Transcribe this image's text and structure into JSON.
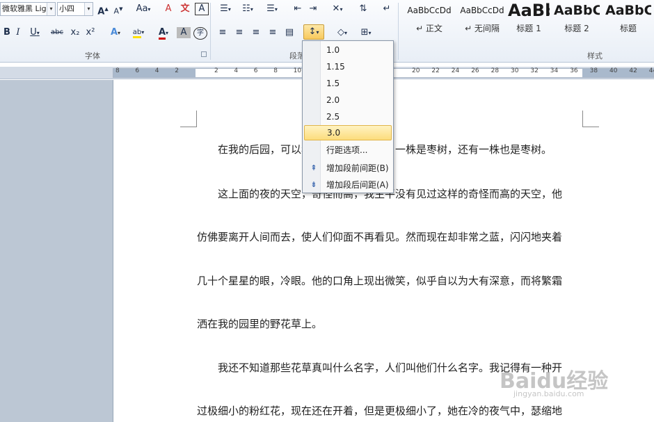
{
  "ribbon": {
    "font_group_label": "字体",
    "paragraph_group_label": "段落",
    "styles_group_label": "样式",
    "font_name": "微软雅黑 Ligh",
    "font_size": "小四",
    "grow_font": "A",
    "shrink_font": "A",
    "change_case": "Aa",
    "bold": "B",
    "italic": "I",
    "underline": "U",
    "strikethrough": "abc",
    "subscript": "x₂",
    "superscript": "x²",
    "text_effect": "A",
    "highlight": "ab",
    "font_color": "A",
    "char_shading": "A",
    "enclose_char": "字",
    "clear_format": "A",
    "phonetic": "文",
    "char_border": "A",
    "styles": [
      {
        "sample": "AaBbCcDd",
        "name": "↵ 正文"
      },
      {
        "sample": "AaBbCcDd",
        "name": "↵ 无间隔"
      },
      {
        "sample": "AaBb",
        "name": "标题 1"
      },
      {
        "sample": "AaBbC",
        "name": "标题 2"
      },
      {
        "sample": "AaBbC",
        "name": "标题"
      }
    ]
  },
  "ruler": {
    "ticks": [
      "8",
      "6",
      "4",
      "2",
      "",
      "2",
      "4",
      "6",
      "8",
      "10",
      "12",
      "",
      "",
      "",
      "",
      "20",
      "22",
      "24",
      "26",
      "28",
      "30",
      "32",
      "34",
      "36",
      "38",
      "40",
      "42",
      "44",
      "46"
    ]
  },
  "line_spacing_menu": {
    "options": [
      "1.0",
      "1.15",
      "1.5",
      "2.0",
      "2.5",
      "3.0"
    ],
    "selected": "3.0",
    "spacing_options_label": "行距选项...",
    "add_before_label": "增加段前间距(B)",
    "add_after_label": "增加段后间距(A)"
  },
  "document": {
    "lines": [
      "　　在我的后园，可以看见墙外有两株树，一株是枣树，还有一株也是枣树。",
      "　　这上面的夜的天空，奇怪而高，我生平没有见过这样的奇怪而高的天空，他",
      "仿佛要离开人间而去，使人们仰面不再看见。然而现在却非常之蓝，闪闪地夹着",
      "几十个星星的眼，冷眼。他的口角上现出微笑，似乎自以为大有深意，而将繁霜",
      "洒在我的园里的野花草上。",
      "　　我还不知道那些花草真叫什么名字，人们叫他们什么名字。我记得有一种开",
      "过极细小的粉红花，现在还在开着，但是更极细小了，她在冷的夜气中，瑟缩地"
    ]
  },
  "watermark": {
    "text": "Baidu经验",
    "sub": "jingyan.baidu.com"
  }
}
